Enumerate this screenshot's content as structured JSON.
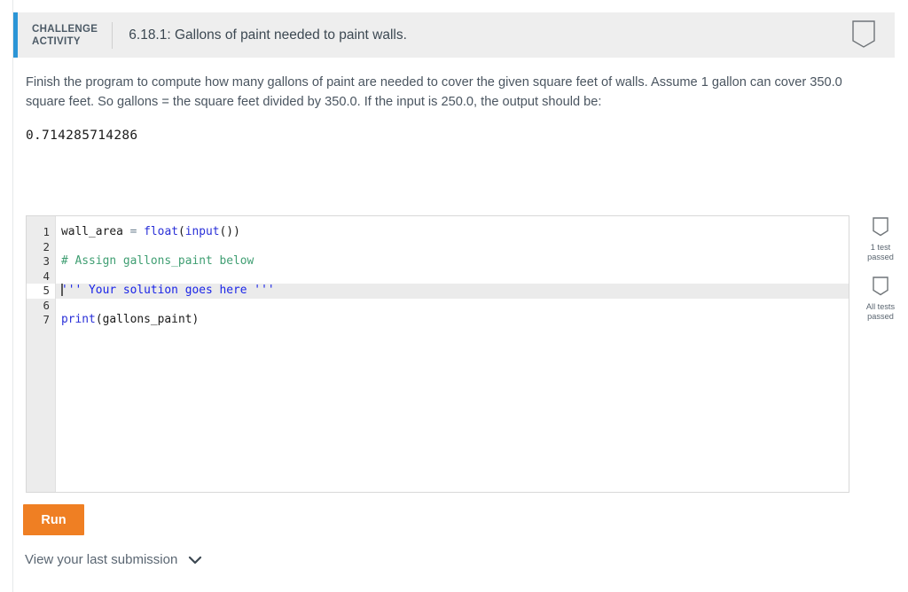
{
  "header": {
    "kicker_line1": "CHALLENGE",
    "kicker_line2": "ACTIVITY",
    "title": "6.18.1: Gallons of paint needed to paint walls.",
    "badge_icon": "shield-bookmark-icon",
    "accent_color": "#2b95d6",
    "background_color": "#eeeeee"
  },
  "description": {
    "text": "Finish the program to compute how many gallons of paint are needed to cover the given square feet of walls. Assume 1 gallon can cover 350.0 square feet. So gallons = the square feet divided by 350.0. If the input is 250.0, the output should be:",
    "sample_output": "0.714285714286"
  },
  "editor": {
    "language": "python",
    "active_line": 5,
    "line_numbers": [
      "1",
      "2",
      "3",
      "4",
      "5",
      "6",
      "7"
    ],
    "lines": [
      {
        "number": "1",
        "tokens": [
          {
            "text": "wall_area",
            "type": "var"
          },
          {
            "text": " ",
            "type": "plain"
          },
          {
            "text": "=",
            "type": "op"
          },
          {
            "text": " ",
            "type": "plain"
          },
          {
            "text": "float",
            "type": "fn"
          },
          {
            "text": "(",
            "type": "punct"
          },
          {
            "text": "input",
            "type": "fn"
          },
          {
            "text": "())",
            "type": "punct"
          }
        ]
      },
      {
        "number": "2",
        "tokens": []
      },
      {
        "number": "3",
        "tokens": [
          {
            "text": "# Assign gallons_paint below",
            "type": "comment"
          }
        ]
      },
      {
        "number": "4",
        "tokens": []
      },
      {
        "number": "5",
        "tokens": [
          {
            "text": "''' Your solution goes here '''",
            "type": "string"
          }
        ]
      },
      {
        "number": "6",
        "tokens": []
      },
      {
        "number": "7",
        "tokens": [
          {
            "text": "print",
            "type": "fn"
          },
          {
            "text": "(",
            "type": "punct"
          },
          {
            "text": "gallons_paint",
            "type": "var"
          },
          {
            "text": ")",
            "type": "punct"
          }
        ]
      }
    ]
  },
  "tests": [
    {
      "icon": "shield-bookmark-icon",
      "caption_line1": "1 test",
      "caption_line2": "passed"
    },
    {
      "icon": "shield-bookmark-icon",
      "caption_line1": "All tests",
      "caption_line2": "passed"
    }
  ],
  "footer": {
    "run_label": "Run",
    "run_color": "#ef7f23",
    "last_submission_label": "View your last submission",
    "chevron_icon": "chevron-down-icon"
  }
}
